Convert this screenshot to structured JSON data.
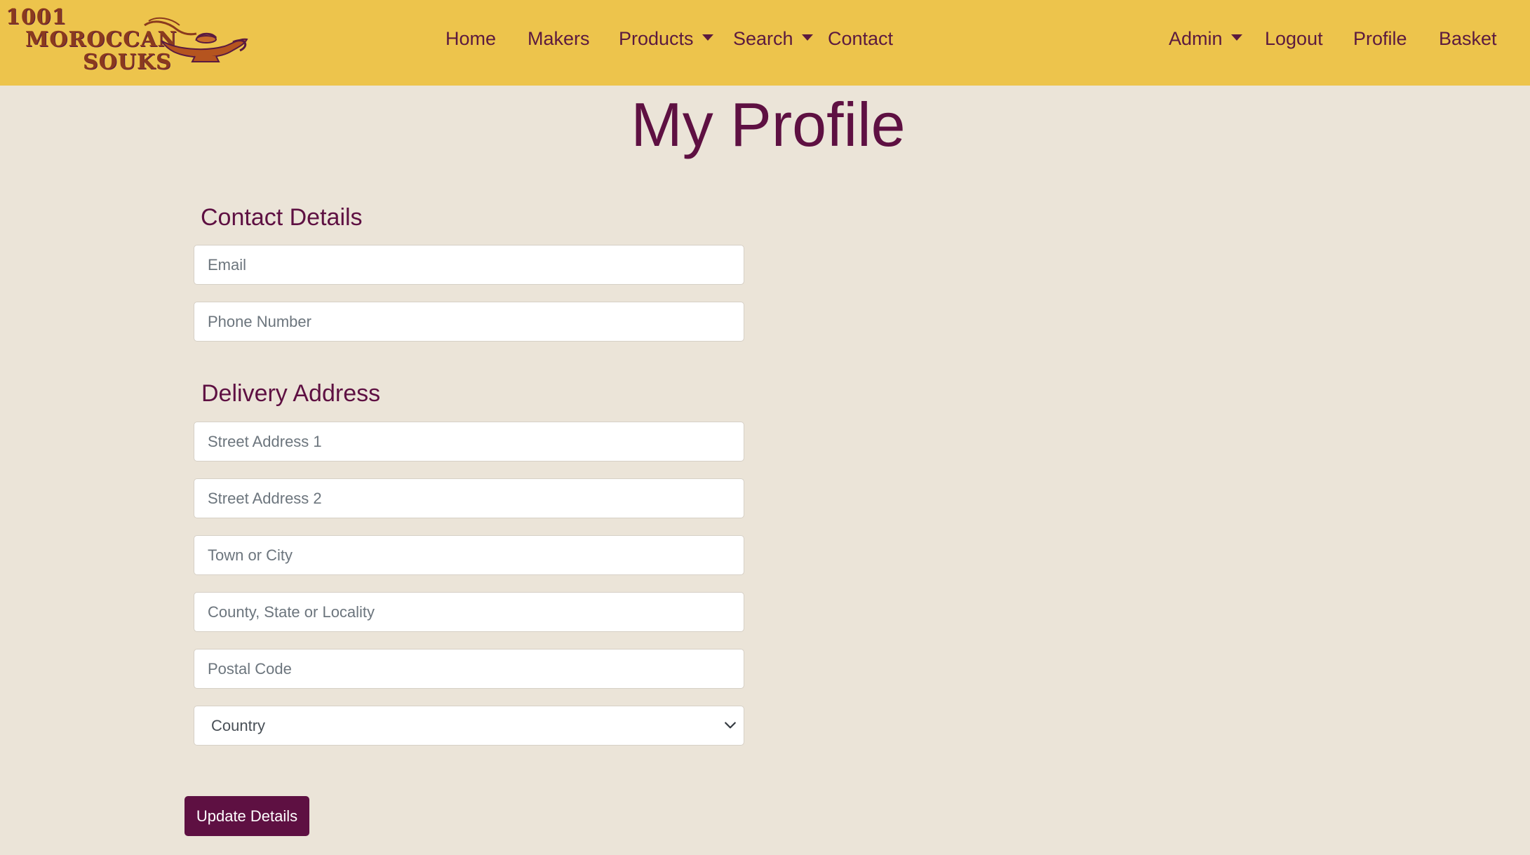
{
  "brand": {
    "logo_lines": [
      "1001",
      "MOROCCAN",
      "SOUKS"
    ]
  },
  "nav": {
    "left": [
      {
        "label": "Home",
        "dropdown": false
      },
      {
        "label": "Makers",
        "dropdown": false
      },
      {
        "label": "Products",
        "dropdown": true
      },
      {
        "label": "Search",
        "dropdown": true
      },
      {
        "label": "Contact",
        "dropdown": false
      }
    ],
    "right": [
      {
        "label": "Admin",
        "dropdown": true
      },
      {
        "label": "Logout",
        "dropdown": false
      },
      {
        "label": "Profile",
        "dropdown": false
      },
      {
        "label": "Basket",
        "dropdown": false
      }
    ]
  },
  "page": {
    "title": "My Profile"
  },
  "contact": {
    "heading": "Contact Details",
    "email_placeholder": "Email",
    "phone_placeholder": "Phone Number"
  },
  "delivery": {
    "heading": "Delivery Address",
    "street1_placeholder": "Street Address 1",
    "street2_placeholder": "Street Address 2",
    "town_placeholder": "Town or City",
    "county_placeholder": "County, State or Locality",
    "postcode_placeholder": "Postal Code",
    "country_selected": "Country"
  },
  "actions": {
    "update_label": "Update Details"
  },
  "colors": {
    "navbar": "#edc44c",
    "background": "#ebe4d8",
    "primary": "#5e1042",
    "nav_text": "#5b1a3f"
  },
  "icons": {
    "lamp": "magic-lamp-icon",
    "dropdown": "caret-down-icon",
    "select": "chevron-down-icon"
  }
}
